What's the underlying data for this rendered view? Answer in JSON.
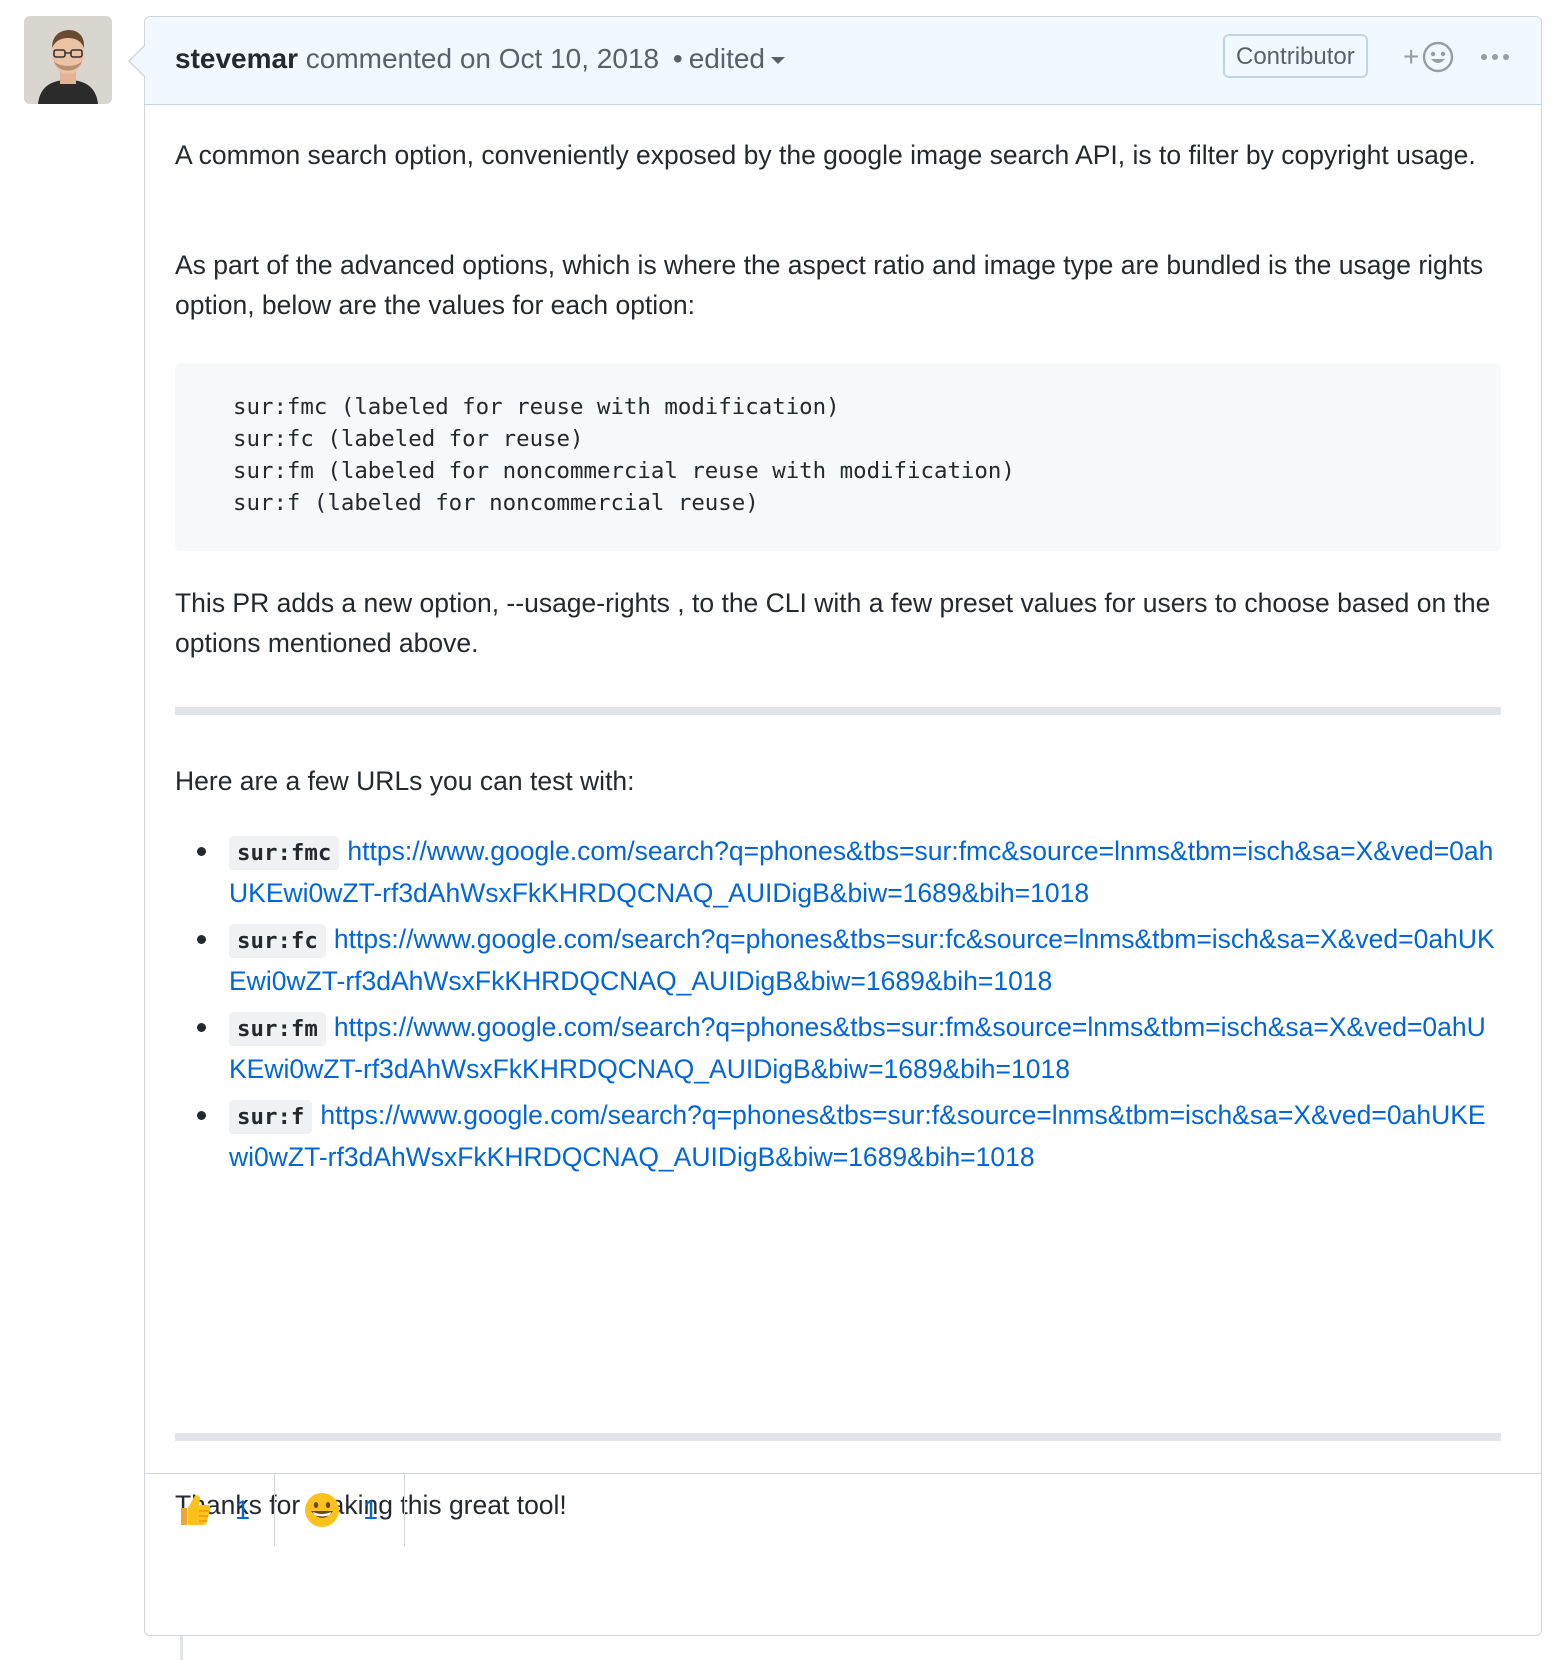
{
  "comment": {
    "author": "stevemar",
    "action": "commented on",
    "date": "Oct 10, 2018",
    "separator": "•",
    "edited_label": "edited",
    "role_badge": "Contributor",
    "add_reaction_plus": "+"
  },
  "body": {
    "paragraph1": "A common search option, conveniently exposed by the google image search API, is to filter by copyright usage.",
    "paragraph2": "As part of the advanced options, which is where the aspect ratio and image type are bundled is the usage rights option, below are the values for each option:",
    "code_lines": [
      "sur:fmc (labeled for reuse with modification)",
      "sur:fc (labeled for reuse)",
      "sur:fm (labeled for noncommercial reuse with modification)",
      "sur:f (labeled for noncommercial reuse)"
    ],
    "paragraph3": "This PR adds a new option, --usage-rights , to the CLI with a few preset values for users to choose based on the options mentioned above.",
    "paragraph4": "Here are a few URLs you can test with:",
    "url_list": [
      {
        "code": "sur:fmc",
        "url": "https://www.google.com/search?q=phones&tbs=sur:fmc&source=lnms&tbm=isch&sa=X&ved=0ahUKEwi0wZT-rf3dAhWsxFkKHRDQCNAQ_AUIDigB&biw=1689&bih=1018"
      },
      {
        "code": "sur:fc",
        "url": "https://www.google.com/search?q=phones&tbs=sur:fc&source=lnms&tbm=isch&sa=X&ved=0ahUKEwi0wZT-rf3dAhWsxFkKHRDQCNAQ_AUIDigB&biw=1689&bih=1018"
      },
      {
        "code": "sur:fm",
        "url": "https://www.google.com/search?q=phones&tbs=sur:fm&source=lnms&tbm=isch&sa=X&ved=0ahUKEwi0wZT-rf3dAhWsxFkKHRDQCNAQ_AUIDigB&biw=1689&bih=1018"
      },
      {
        "code": "sur:f",
        "url": "https://www.google.com/search?q=phones&tbs=sur:f&source=lnms&tbm=isch&sa=X&ved=0ahUKEwi0wZT-rf3dAhWsxFkKHRDQCNAQ_AUIDigB&biw=1689&bih=1018"
      }
    ],
    "paragraph5": "Thanks for making this great tool!"
  },
  "reactions": [
    {
      "emoji": "thumbs-up-icon",
      "count": "1"
    },
    {
      "emoji": "smile-icon",
      "count": "1"
    }
  ],
  "colors": {
    "link": "#0366d6",
    "header_bg": "#f1f8ff",
    "border": "#d1d5da"
  }
}
